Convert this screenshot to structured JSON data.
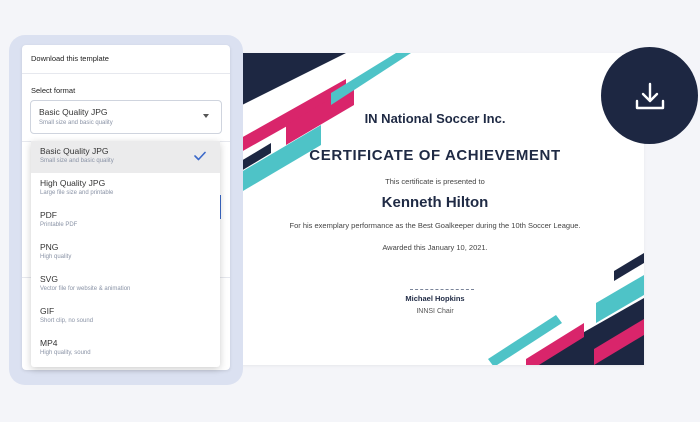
{
  "certificate": {
    "organization": "IN National Soccer Inc.",
    "title": "CERTIFICATE OF ACHIEVEMENT",
    "presented_text": "This certificate is presented to",
    "recipient": "Kenneth Hilton",
    "description": "For his exemplary performance as the Best Goalkeeper during the 10th Soccer League.",
    "awarded": "Awarded this January 10, 2021.",
    "signatory_name": "Michael Hopkins",
    "signatory_role": "INNSI Chair"
  },
  "download_panel": {
    "title": "Download this template",
    "select_label": "Select format",
    "selected_value": "Basic Quality JPG",
    "selected_description": "Small size and basic quality"
  },
  "format_options": [
    {
      "label": "Basic Quality JPG",
      "description": "Small size and basic quality",
      "selected": true
    },
    {
      "label": "High Quality JPG",
      "description": "Large file size and printable"
    },
    {
      "label": "PDF",
      "description": "Printable PDF"
    },
    {
      "label": "PNG",
      "description": "High quality"
    },
    {
      "label": "SVG",
      "description": "Vector file for website & animation"
    },
    {
      "label": "GIF",
      "description": "Short clip, no sound"
    },
    {
      "label": "MP4",
      "description": "High quality, sound"
    }
  ],
  "icons": {
    "download": "download-icon",
    "caret": "caret-down-icon",
    "check": "check-icon"
  },
  "colors": {
    "navy": "#1d2742",
    "teal": "#4ec3c7",
    "magenta": "#d9256b",
    "accent_blue": "#3b69c9",
    "panel_frame": "#dbe1f1"
  }
}
